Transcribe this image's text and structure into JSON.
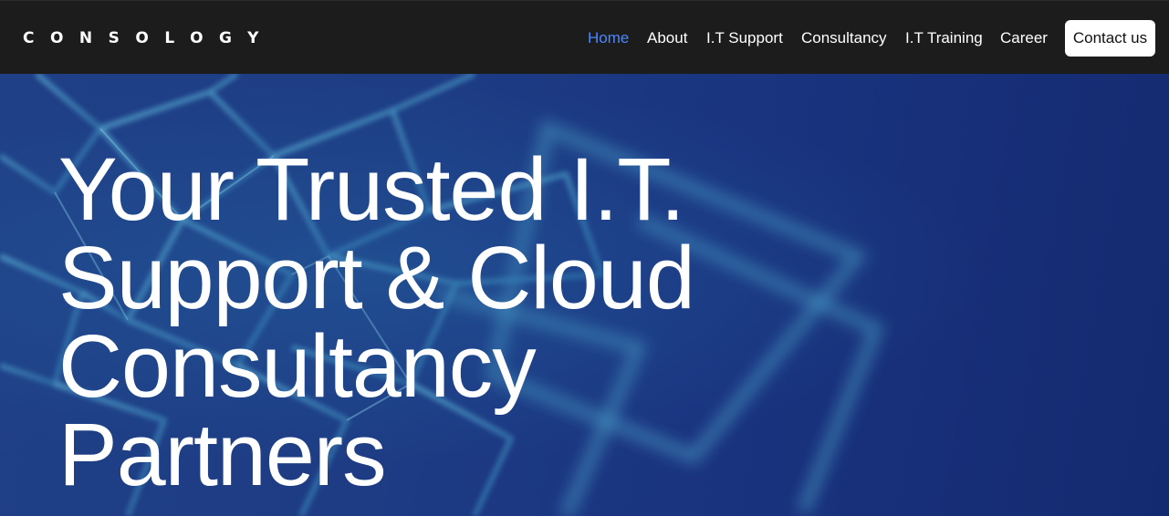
{
  "brand": {
    "logo_text": "CONSOLOGY"
  },
  "nav": {
    "items": [
      {
        "label": "Home",
        "active": true
      },
      {
        "label": "About",
        "active": false
      },
      {
        "label": "I.T Support",
        "active": false
      },
      {
        "label": "Consultancy",
        "active": false
      },
      {
        "label": "I.T Training",
        "active": false
      },
      {
        "label": "Career",
        "active": false
      }
    ],
    "contact_label": "Contact us"
  },
  "hero": {
    "title_lines": [
      "Your Trusted I.T.",
      "Support & Cloud",
      "Consultancy",
      "Partners"
    ],
    "background_image": "abstract-blue-crystal-lattice"
  },
  "colors": {
    "navbar_bg": "#1c1c1c",
    "nav_active": "#4a86ff",
    "nav_text": "#ffffff",
    "hero_bg": "#1d3c84",
    "button_bg": "#ffffff",
    "button_text": "#111111"
  }
}
